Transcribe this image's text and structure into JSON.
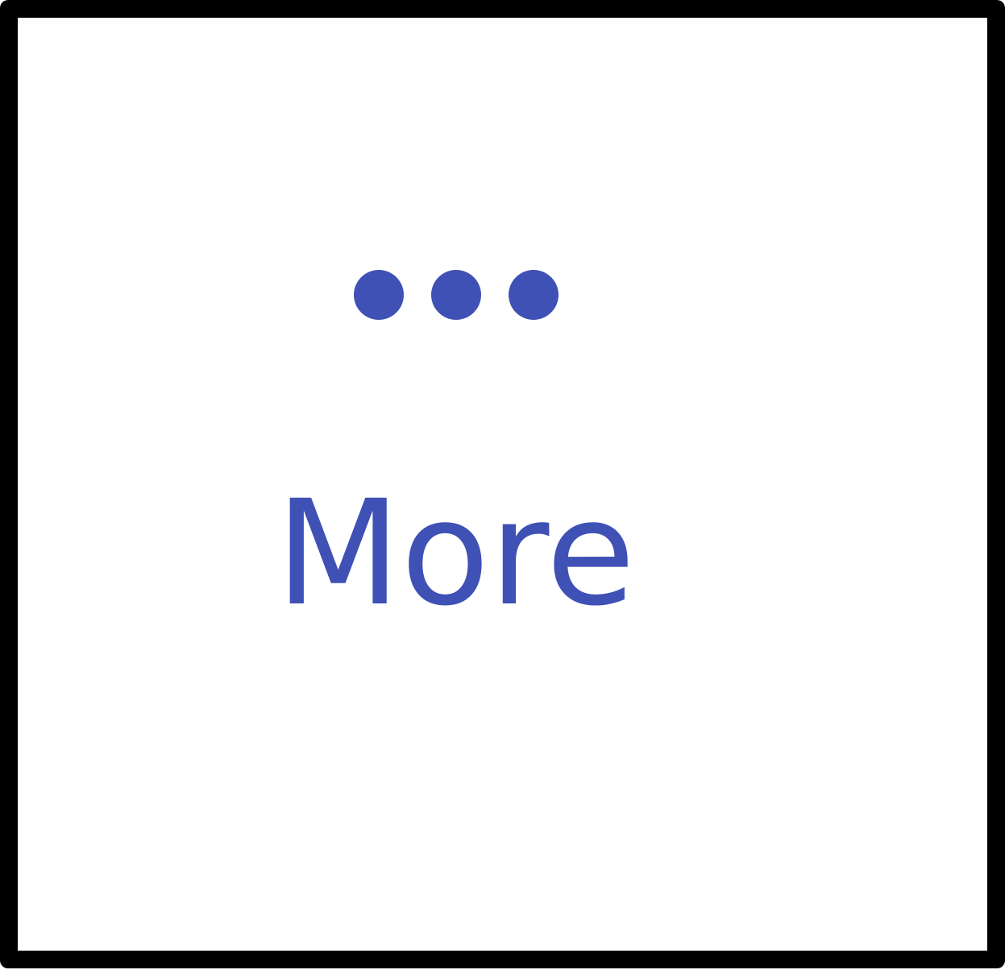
{
  "button": {
    "label": "More",
    "icon": "ellipsis-horizontal-icon"
  },
  "colors": {
    "accent": "#3f51b5",
    "frame": "#000000",
    "background": "#ffffff"
  }
}
